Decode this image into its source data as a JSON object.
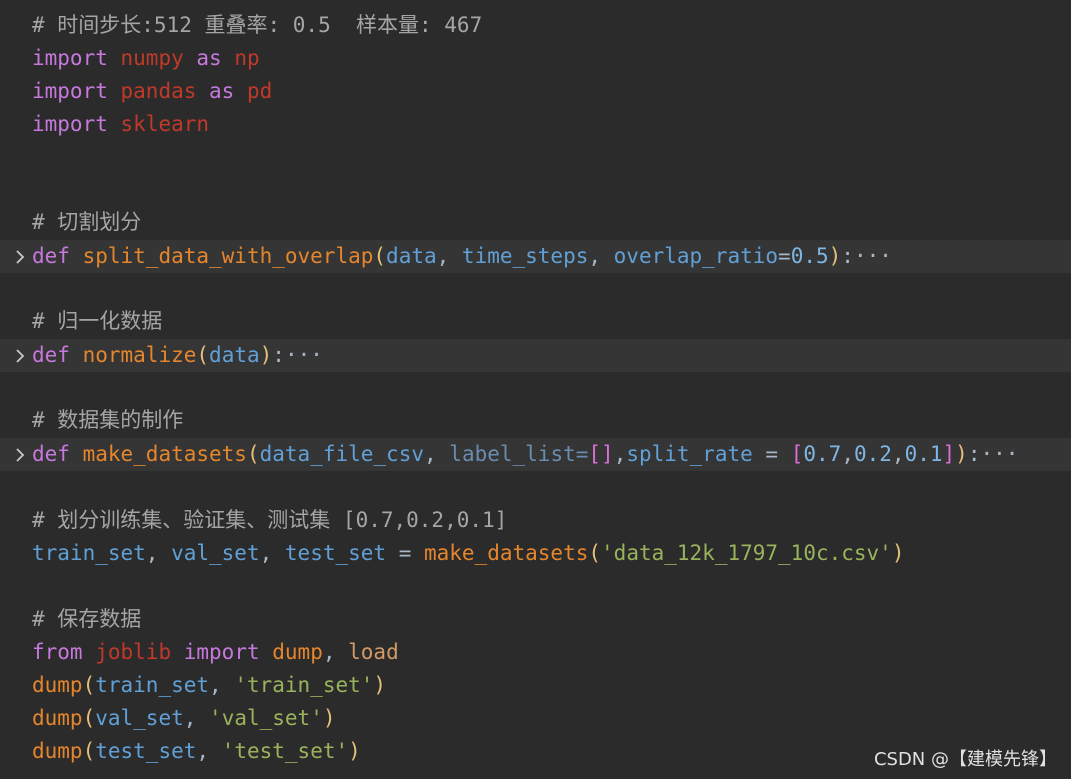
{
  "header": {
    "comment": "# 时间步长:512 重叠率: 0.5  样本量: 467"
  },
  "imports": {
    "import_kw": "import",
    "as_kw": "as",
    "numpy": "numpy",
    "np": "np",
    "pandas": "pandas",
    "pd": "pd",
    "sklearn": "sklearn"
  },
  "split_section": {
    "comment": "# 切割划分",
    "def_kw": "def",
    "fn_name": "split_data_with_overlap",
    "open": "(",
    "p1": "data",
    "comma": ", ",
    "p2": "time_steps",
    "p3": "overlap_ratio",
    "eq": "=",
    "default": "0.5",
    "close": ")",
    "colon": ":",
    "ellipsis": "···"
  },
  "normalize_section": {
    "comment": "# 归一化数据",
    "def_kw": "def",
    "fn_name": "normalize",
    "open": "(",
    "p1": "data",
    "close": ")",
    "colon": ":",
    "ellipsis": "···"
  },
  "datasets_section": {
    "comment": "# 数据集的制作",
    "def_kw": "def",
    "fn_name": "make_datasets",
    "open": "(",
    "p1": "data_file_csv",
    "comma": ", ",
    "p2": "label_list",
    "eq": "=",
    "empty_list": "[]",
    "comma2": ",",
    "p3": "split_rate",
    "eq2": " = ",
    "lbr": "[",
    "v1": "0.7",
    "c": ",",
    "v2": "0.2",
    "v3": "0.1",
    "rbr": "]",
    "close": ")",
    "colon": ":",
    "ellipsis": "···"
  },
  "train_section": {
    "comment": "# 划分训练集、验证集、测试集 [0.7,0.2,0.1]",
    "v1": "train_set",
    "comma": ", ",
    "v2": "val_set",
    "v3": "test_set",
    "eq": " = ",
    "fn": "make_datasets",
    "open": "(",
    "arg": "'data_12k_1797_10c.csv'",
    "close": ")"
  },
  "save_section": {
    "comment": "# 保存数据",
    "from_kw": "from",
    "joblib": "joblib",
    "import_kw": "import",
    "dump": "dump",
    "comma": ", ",
    "load": "load",
    "calls": [
      {
        "fn": "dump",
        "var": "train_set",
        "str": "'train_set'"
      },
      {
        "fn": "dump",
        "var": "val_set",
        "str": "'val_set'"
      },
      {
        "fn": "dump",
        "var": "test_set",
        "str": "'test_set'"
      }
    ]
  },
  "watermark": "CSDN @【建模先锋】"
}
